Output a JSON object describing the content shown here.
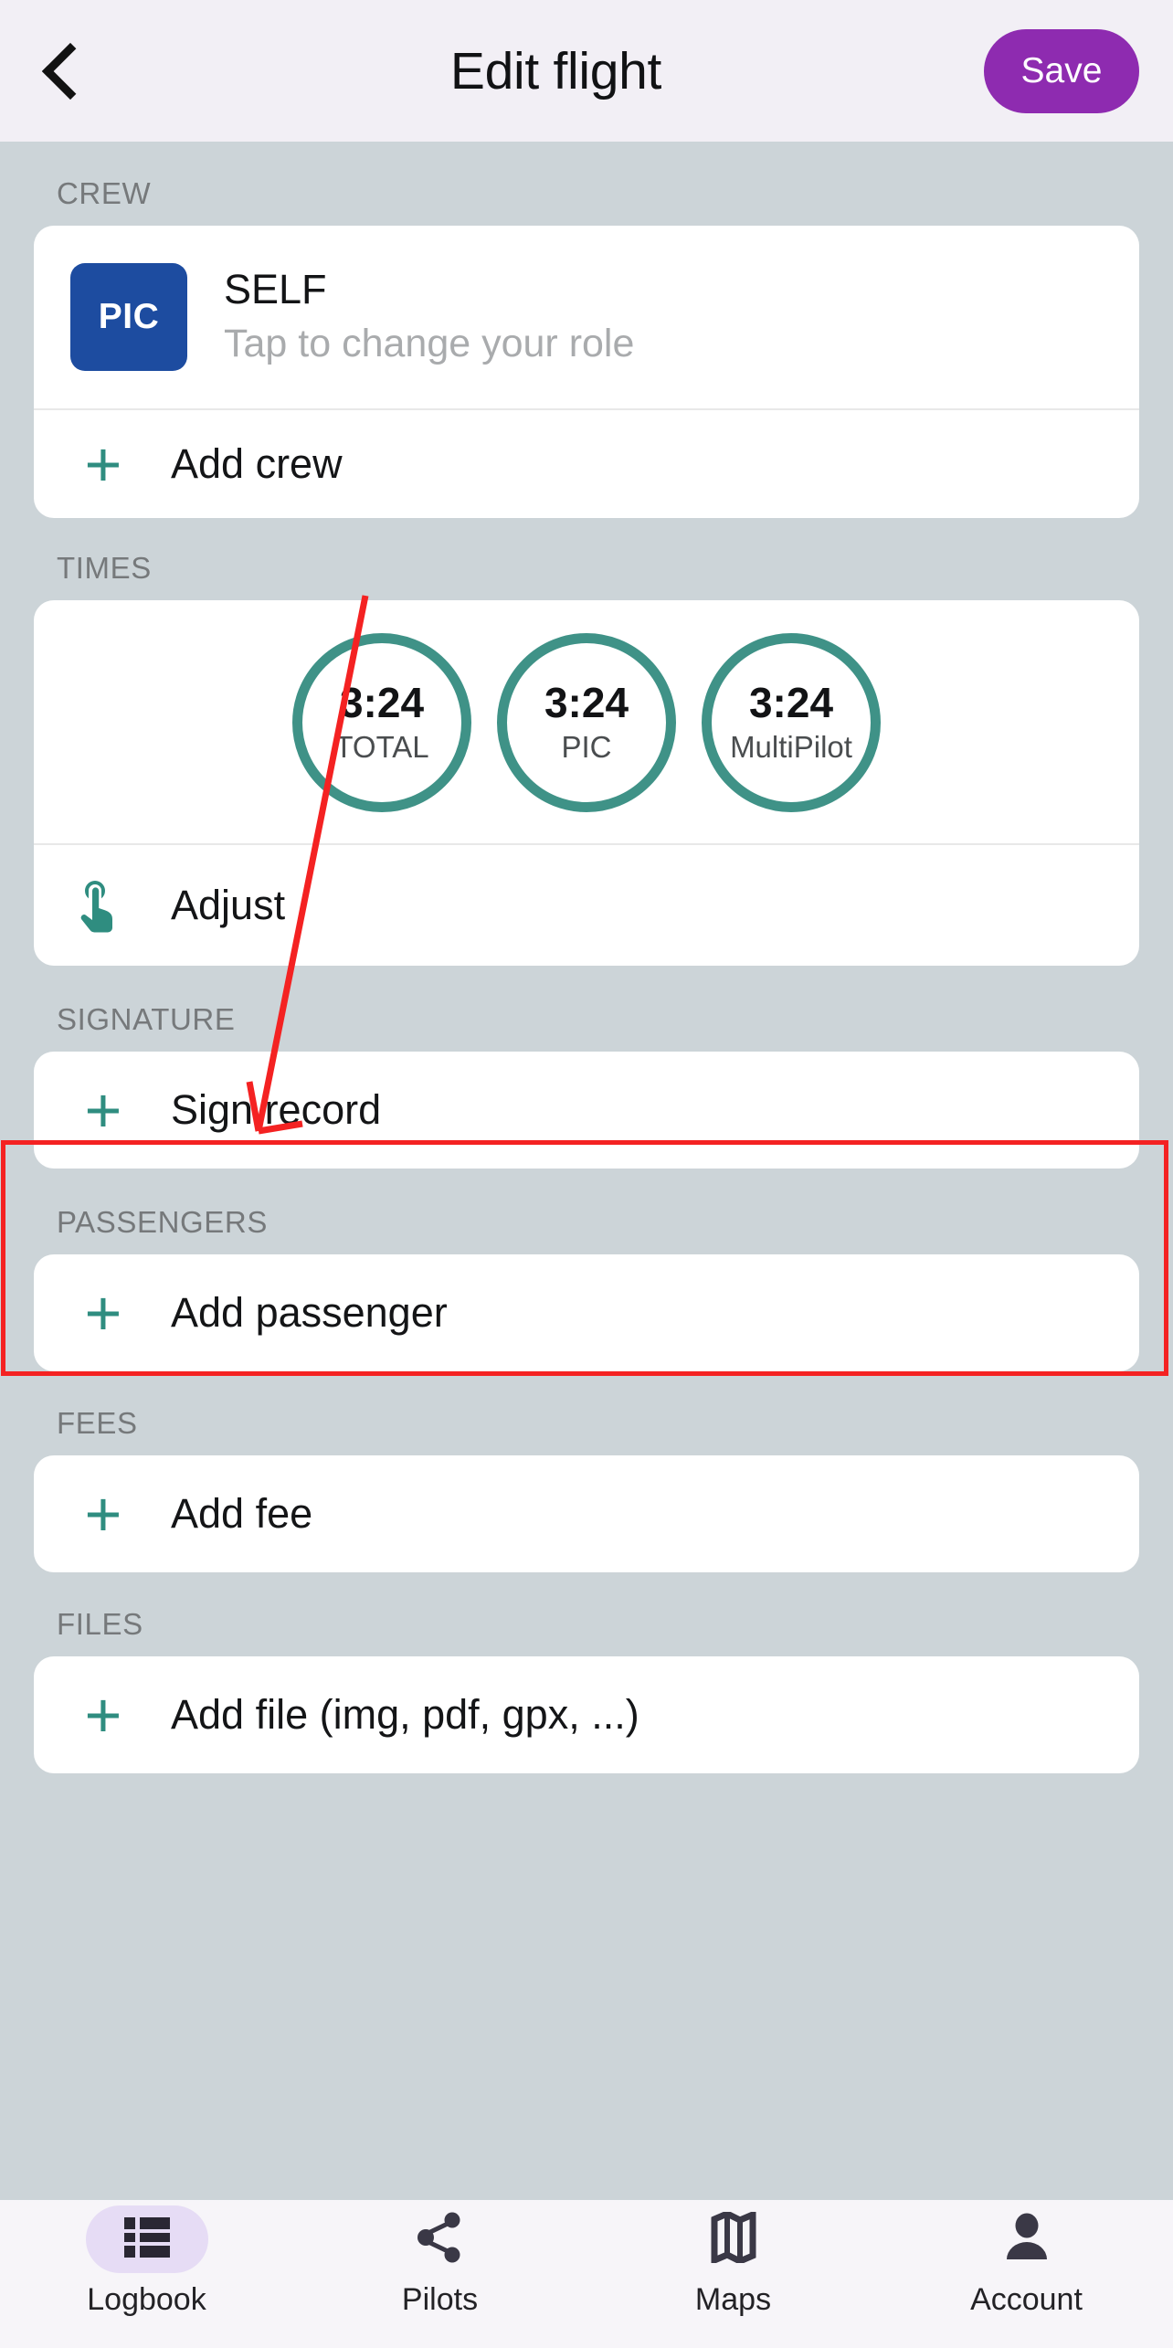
{
  "header": {
    "back_icon": "chevron-left-icon",
    "title": "Edit flight",
    "save_label": "Save",
    "save_color": "#8e2bb0"
  },
  "theme": {
    "page_background": "#ccd4d8",
    "card_background": "#ffffff",
    "accent_teal": "#2f8d80",
    "ring_teal": "#3f9287",
    "badge_blue": "#1d4ca0",
    "annotation_red": "#f42222",
    "active_tab_pill": "#e6dcf5"
  },
  "sections": {
    "crew": {
      "label": "CREW",
      "self": {
        "badge": "PIC",
        "name": "SELF",
        "subtitle": "Tap to change your role"
      },
      "add_label": "Add crew"
    },
    "times": {
      "label": "TIMES",
      "circles": [
        {
          "value": "3:24",
          "label": "TOTAL"
        },
        {
          "value": "3:24",
          "label": "PIC"
        },
        {
          "value": "3:24",
          "label": "MultiPilot"
        }
      ],
      "adjust_label": "Adjust",
      "adjust_icon": "tap-hand-icon"
    },
    "signature": {
      "label": "SIGNATURE",
      "add_label": "Sign record"
    },
    "passengers": {
      "label": "PASSENGERS",
      "add_label": "Add passenger"
    },
    "fees": {
      "label": "FEES",
      "add_label": "Add fee"
    },
    "files": {
      "label": "FILES",
      "add_label": "Add file (img, pdf, gpx, ...)"
    }
  },
  "tabbar": {
    "items": [
      {
        "label": "Logbook",
        "icon": "list-icon",
        "active": true
      },
      {
        "label": "Pilots",
        "icon": "share-icon",
        "active": false
      },
      {
        "label": "Maps",
        "icon": "map-icon",
        "active": false
      },
      {
        "label": "Account",
        "icon": "person-icon",
        "active": false
      }
    ]
  }
}
